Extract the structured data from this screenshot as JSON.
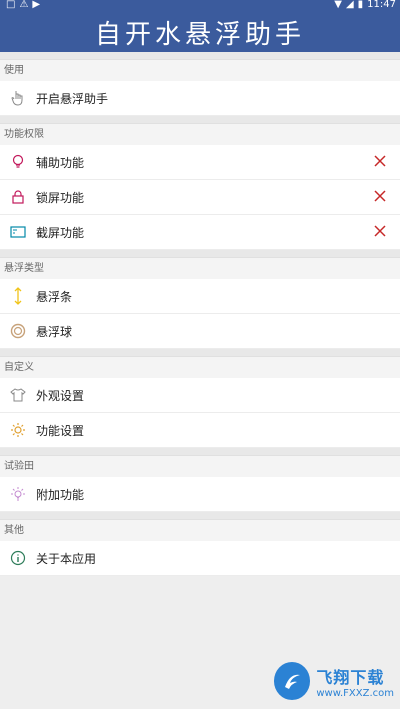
{
  "status": {
    "time": "11:47"
  },
  "appbar": {
    "title": "自开水悬浮助手"
  },
  "sections": {
    "usage": "使用",
    "permissions": "功能权限",
    "float_type": "悬浮类型",
    "custom": "自定义",
    "lab": "试验田",
    "other": "其他"
  },
  "items": {
    "enable": "开启悬浮助手",
    "accessibility": "辅助功能",
    "lock": "锁屏功能",
    "screenshot": "截屏功能",
    "bar": "悬浮条",
    "ball": "悬浮球",
    "appearance": "外观设置",
    "function": "功能设置",
    "extra": "附加功能",
    "about": "关于本应用"
  },
  "watermark": {
    "big": "飞翔下载",
    "small": "www.FXXZ.com"
  },
  "colors": {
    "primary": "#3b5b9d",
    "error": "#c62828",
    "accent": "#f0c419"
  }
}
